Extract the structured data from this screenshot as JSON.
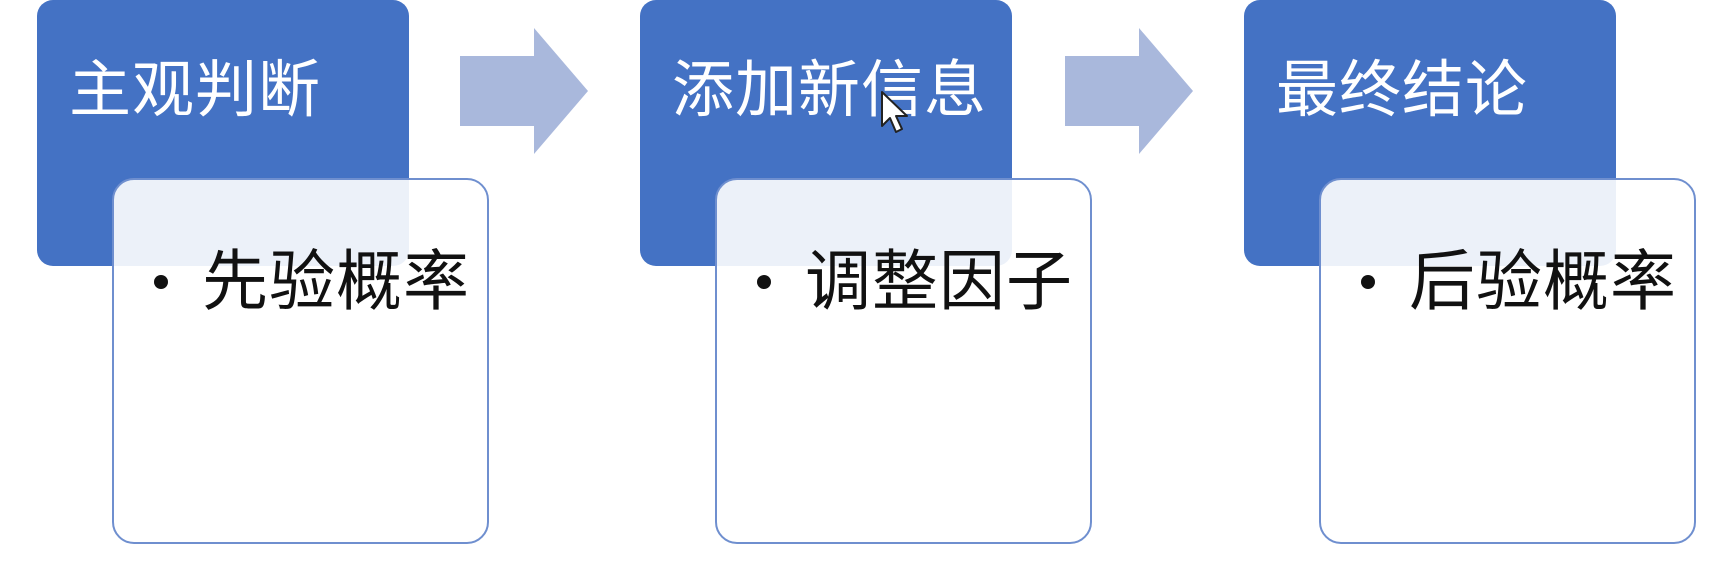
{
  "diagram": {
    "stages": [
      {
        "header": "主观判断",
        "bullet": "先验概率"
      },
      {
        "header": "添加新信息",
        "bullet": "调整因子"
      },
      {
        "header": "最终结论",
        "bullet": "后验概率"
      }
    ],
    "colors": {
      "header_fill": "#4472c4",
      "header_text": "#ffffff",
      "detail_border": "#6f8fcf",
      "detail_fill": "#ffffff",
      "arrow_fill": "#a9b8dc",
      "bullet_text": "#111111"
    },
    "arrows": [
      "right-arrow-icon",
      "right-arrow-icon"
    ]
  }
}
